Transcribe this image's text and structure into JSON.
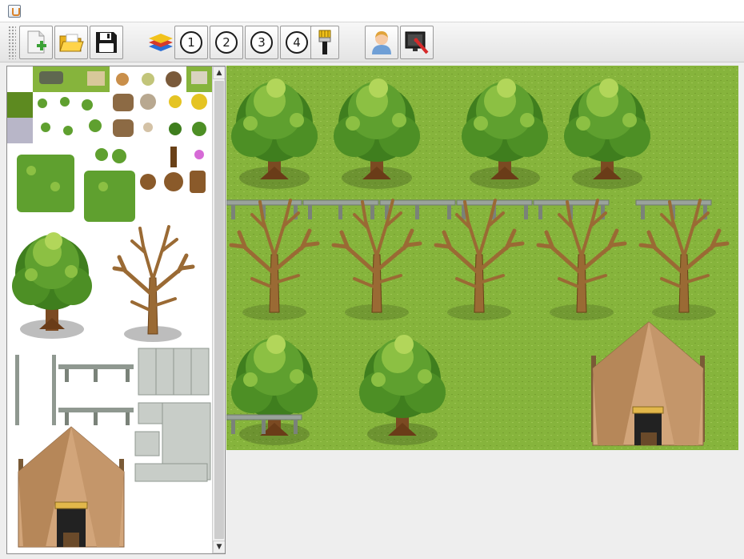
{
  "window": {
    "icon": "java-coffee-icon"
  },
  "toolbar": {
    "buttons": [
      {
        "id": "new",
        "icon": "new-document-plus-icon"
      },
      {
        "id": "open",
        "icon": "open-folder-icon"
      },
      {
        "id": "save",
        "icon": "floppy-disk-icon"
      },
      {
        "id": "layers",
        "icon": "layers-stack-icon"
      },
      {
        "id": "layer1",
        "label": "1"
      },
      {
        "id": "layer2",
        "label": "2"
      },
      {
        "id": "layer3",
        "label": "3"
      },
      {
        "id": "layer4",
        "label": "4"
      },
      {
        "id": "brush",
        "icon": "paint-brush-icon"
      },
      {
        "id": "player",
        "icon": "user-avatar-icon"
      },
      {
        "id": "events",
        "icon": "monitor-brush-icon"
      }
    ]
  },
  "colors": {
    "grass": "#86b43c",
    "grass_dark": "#76a030",
    "tree_foliage": "#4d8f25",
    "tree_highlight": "#a6cf4e",
    "trunk": "#7b4a22",
    "dead_tree": "#9a6a34",
    "fence": "#8f9890",
    "tent": "#d2a57a",
    "tent_dark": "#a97a53",
    "accent_blue": "#2a6fd6"
  },
  "tileset": {
    "scroll_up_glyph": "▲",
    "scroll_down_glyph": "▼"
  }
}
